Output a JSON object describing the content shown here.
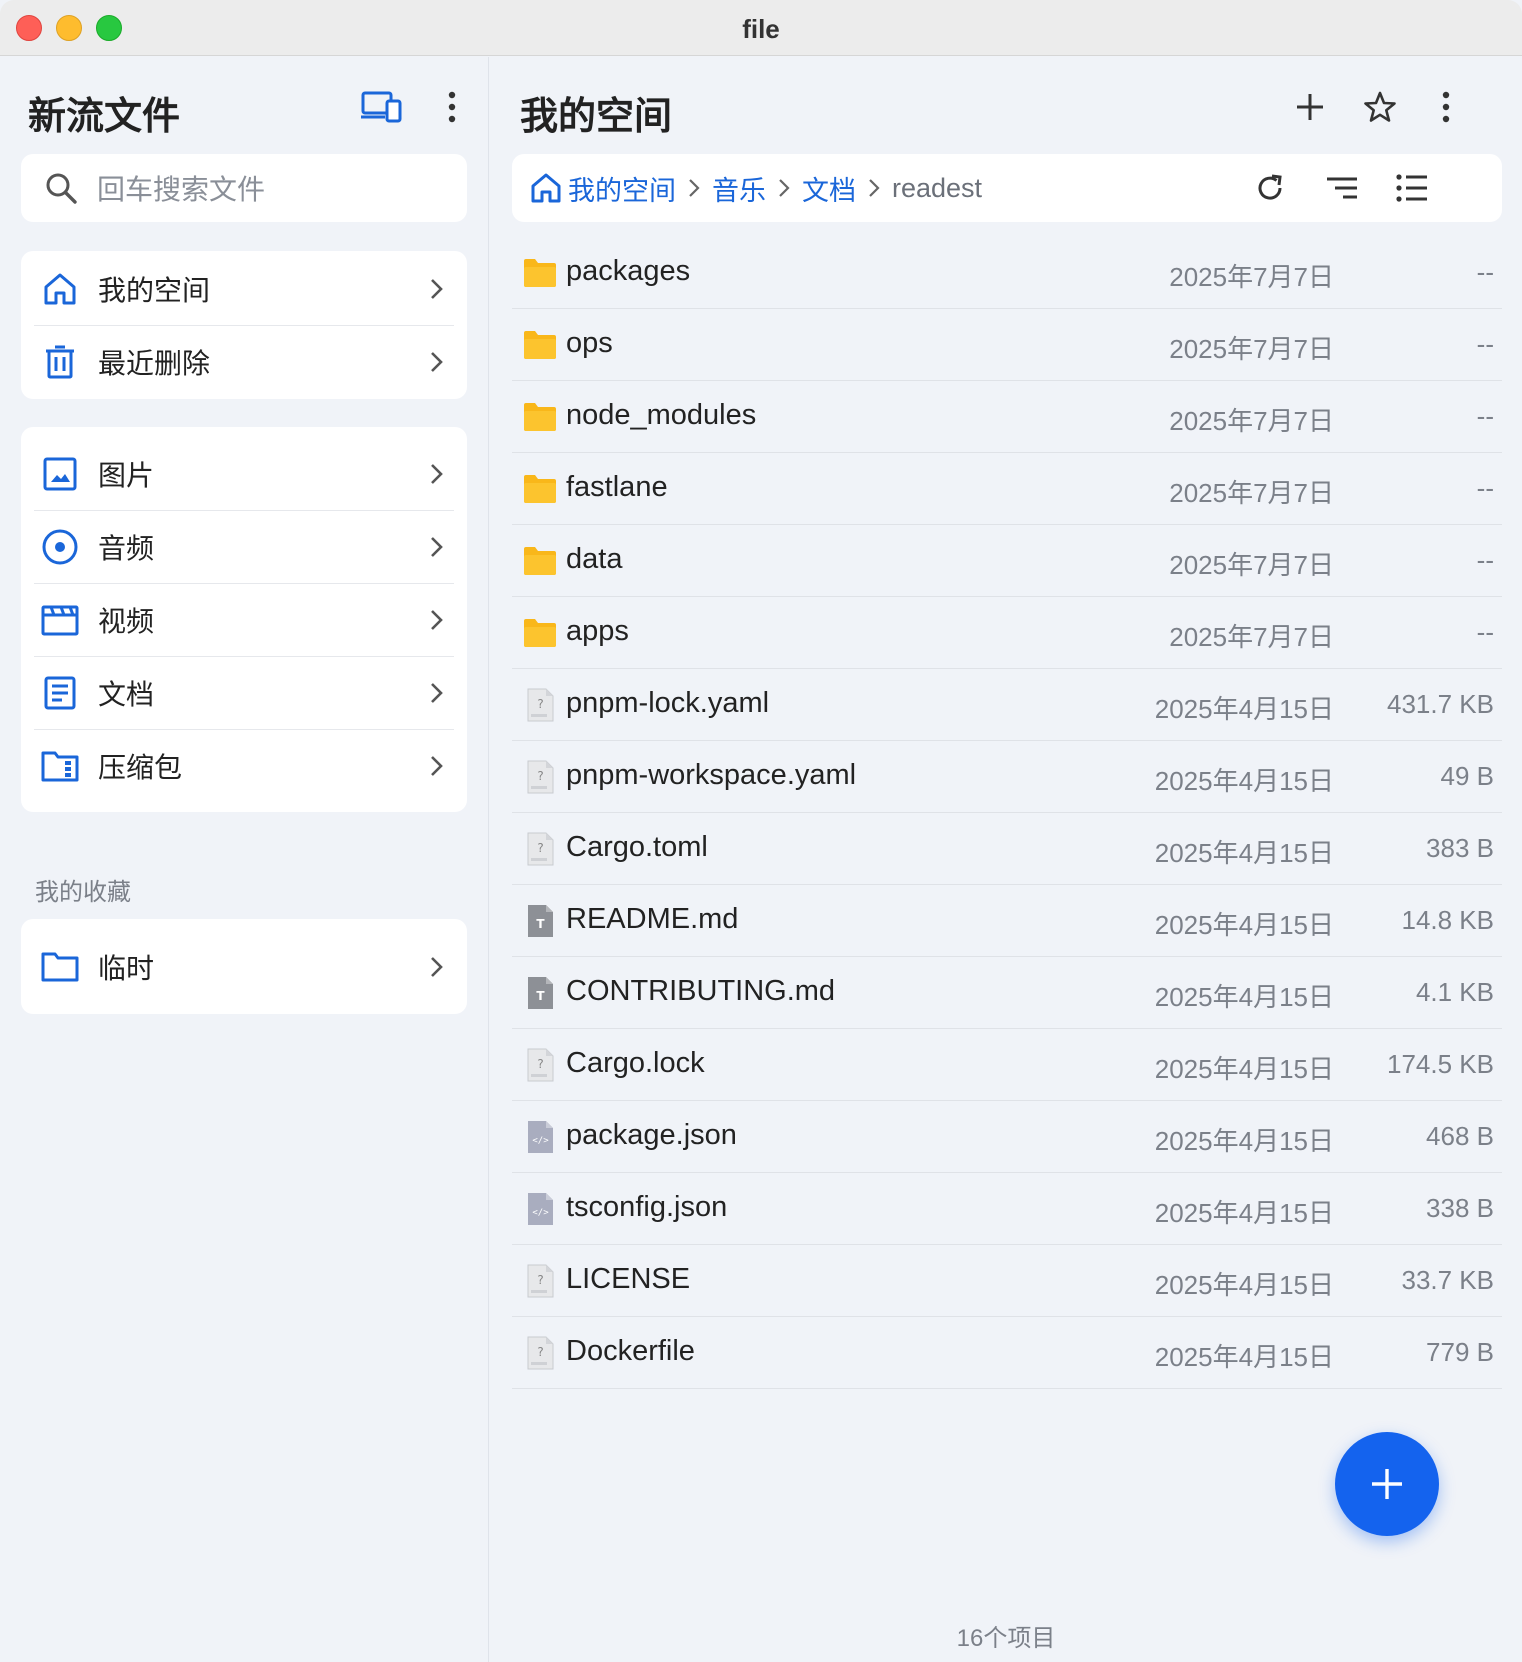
{
  "window": {
    "title": "file"
  },
  "sidebar": {
    "app_title": "新流文件",
    "search_placeholder": "回车搜索文件",
    "primary": [
      {
        "label": "我的空间",
        "icon": "home-icon"
      },
      {
        "label": "最近删除",
        "icon": "trash-icon"
      }
    ],
    "categories": [
      {
        "label": "图片",
        "icon": "image-icon"
      },
      {
        "label": "音频",
        "icon": "audio-icon"
      },
      {
        "label": "视频",
        "icon": "video-icon"
      },
      {
        "label": "文档",
        "icon": "document-icon"
      },
      {
        "label": "压缩包",
        "icon": "archive-icon"
      }
    ],
    "favorites_label": "我的收藏",
    "favorites": [
      {
        "label": "临时",
        "icon": "folder-icon"
      }
    ]
  },
  "main": {
    "title": "我的空间",
    "breadcrumbs": [
      "我的空间",
      "音乐",
      "文档"
    ],
    "current": "readest",
    "files": [
      {
        "name": "packages",
        "date": "2025年7月7日",
        "size": "--",
        "type": "folder"
      },
      {
        "name": "ops",
        "date": "2025年7月7日",
        "size": "--",
        "type": "folder"
      },
      {
        "name": "node_modules",
        "date": "2025年7月7日",
        "size": "--",
        "type": "folder"
      },
      {
        "name": "fastlane",
        "date": "2025年7月7日",
        "size": "--",
        "type": "folder"
      },
      {
        "name": "data",
        "date": "2025年7月7日",
        "size": "--",
        "type": "folder"
      },
      {
        "name": "apps",
        "date": "2025年7月7日",
        "size": "--",
        "type": "folder"
      },
      {
        "name": "pnpm-lock.yaml",
        "date": "2025年4月15日",
        "size": "431.7 KB",
        "type": "unknown"
      },
      {
        "name": "pnpm-workspace.yaml",
        "date": "2025年4月15日",
        "size": "49 B",
        "type": "unknown"
      },
      {
        "name": "Cargo.toml",
        "date": "2025年4月15日",
        "size": "383 B",
        "type": "unknown"
      },
      {
        "name": "README.md",
        "date": "2025年4月15日",
        "size": "14.8 KB",
        "type": "text"
      },
      {
        "name": "CONTRIBUTING.md",
        "date": "2025年4月15日",
        "size": "4.1 KB",
        "type": "text"
      },
      {
        "name": "Cargo.lock",
        "date": "2025年4月15日",
        "size": "174.5 KB",
        "type": "unknown"
      },
      {
        "name": "package.json",
        "date": "2025年4月15日",
        "size": "468 B",
        "type": "code"
      },
      {
        "name": "tsconfig.json",
        "date": "2025年4月15日",
        "size": "338 B",
        "type": "code"
      },
      {
        "name": "LICENSE",
        "date": "2025年4月15日",
        "size": "33.7 KB",
        "type": "unknown"
      },
      {
        "name": "Dockerfile",
        "date": "2025年4月15日",
        "size": "779 B",
        "type": "unknown"
      }
    ],
    "item_count": "16个项目"
  },
  "colors": {
    "accent": "#1463ee",
    "link": "#1a66d9",
    "folder": "#f9b71a",
    "muted": "#7b8089"
  }
}
